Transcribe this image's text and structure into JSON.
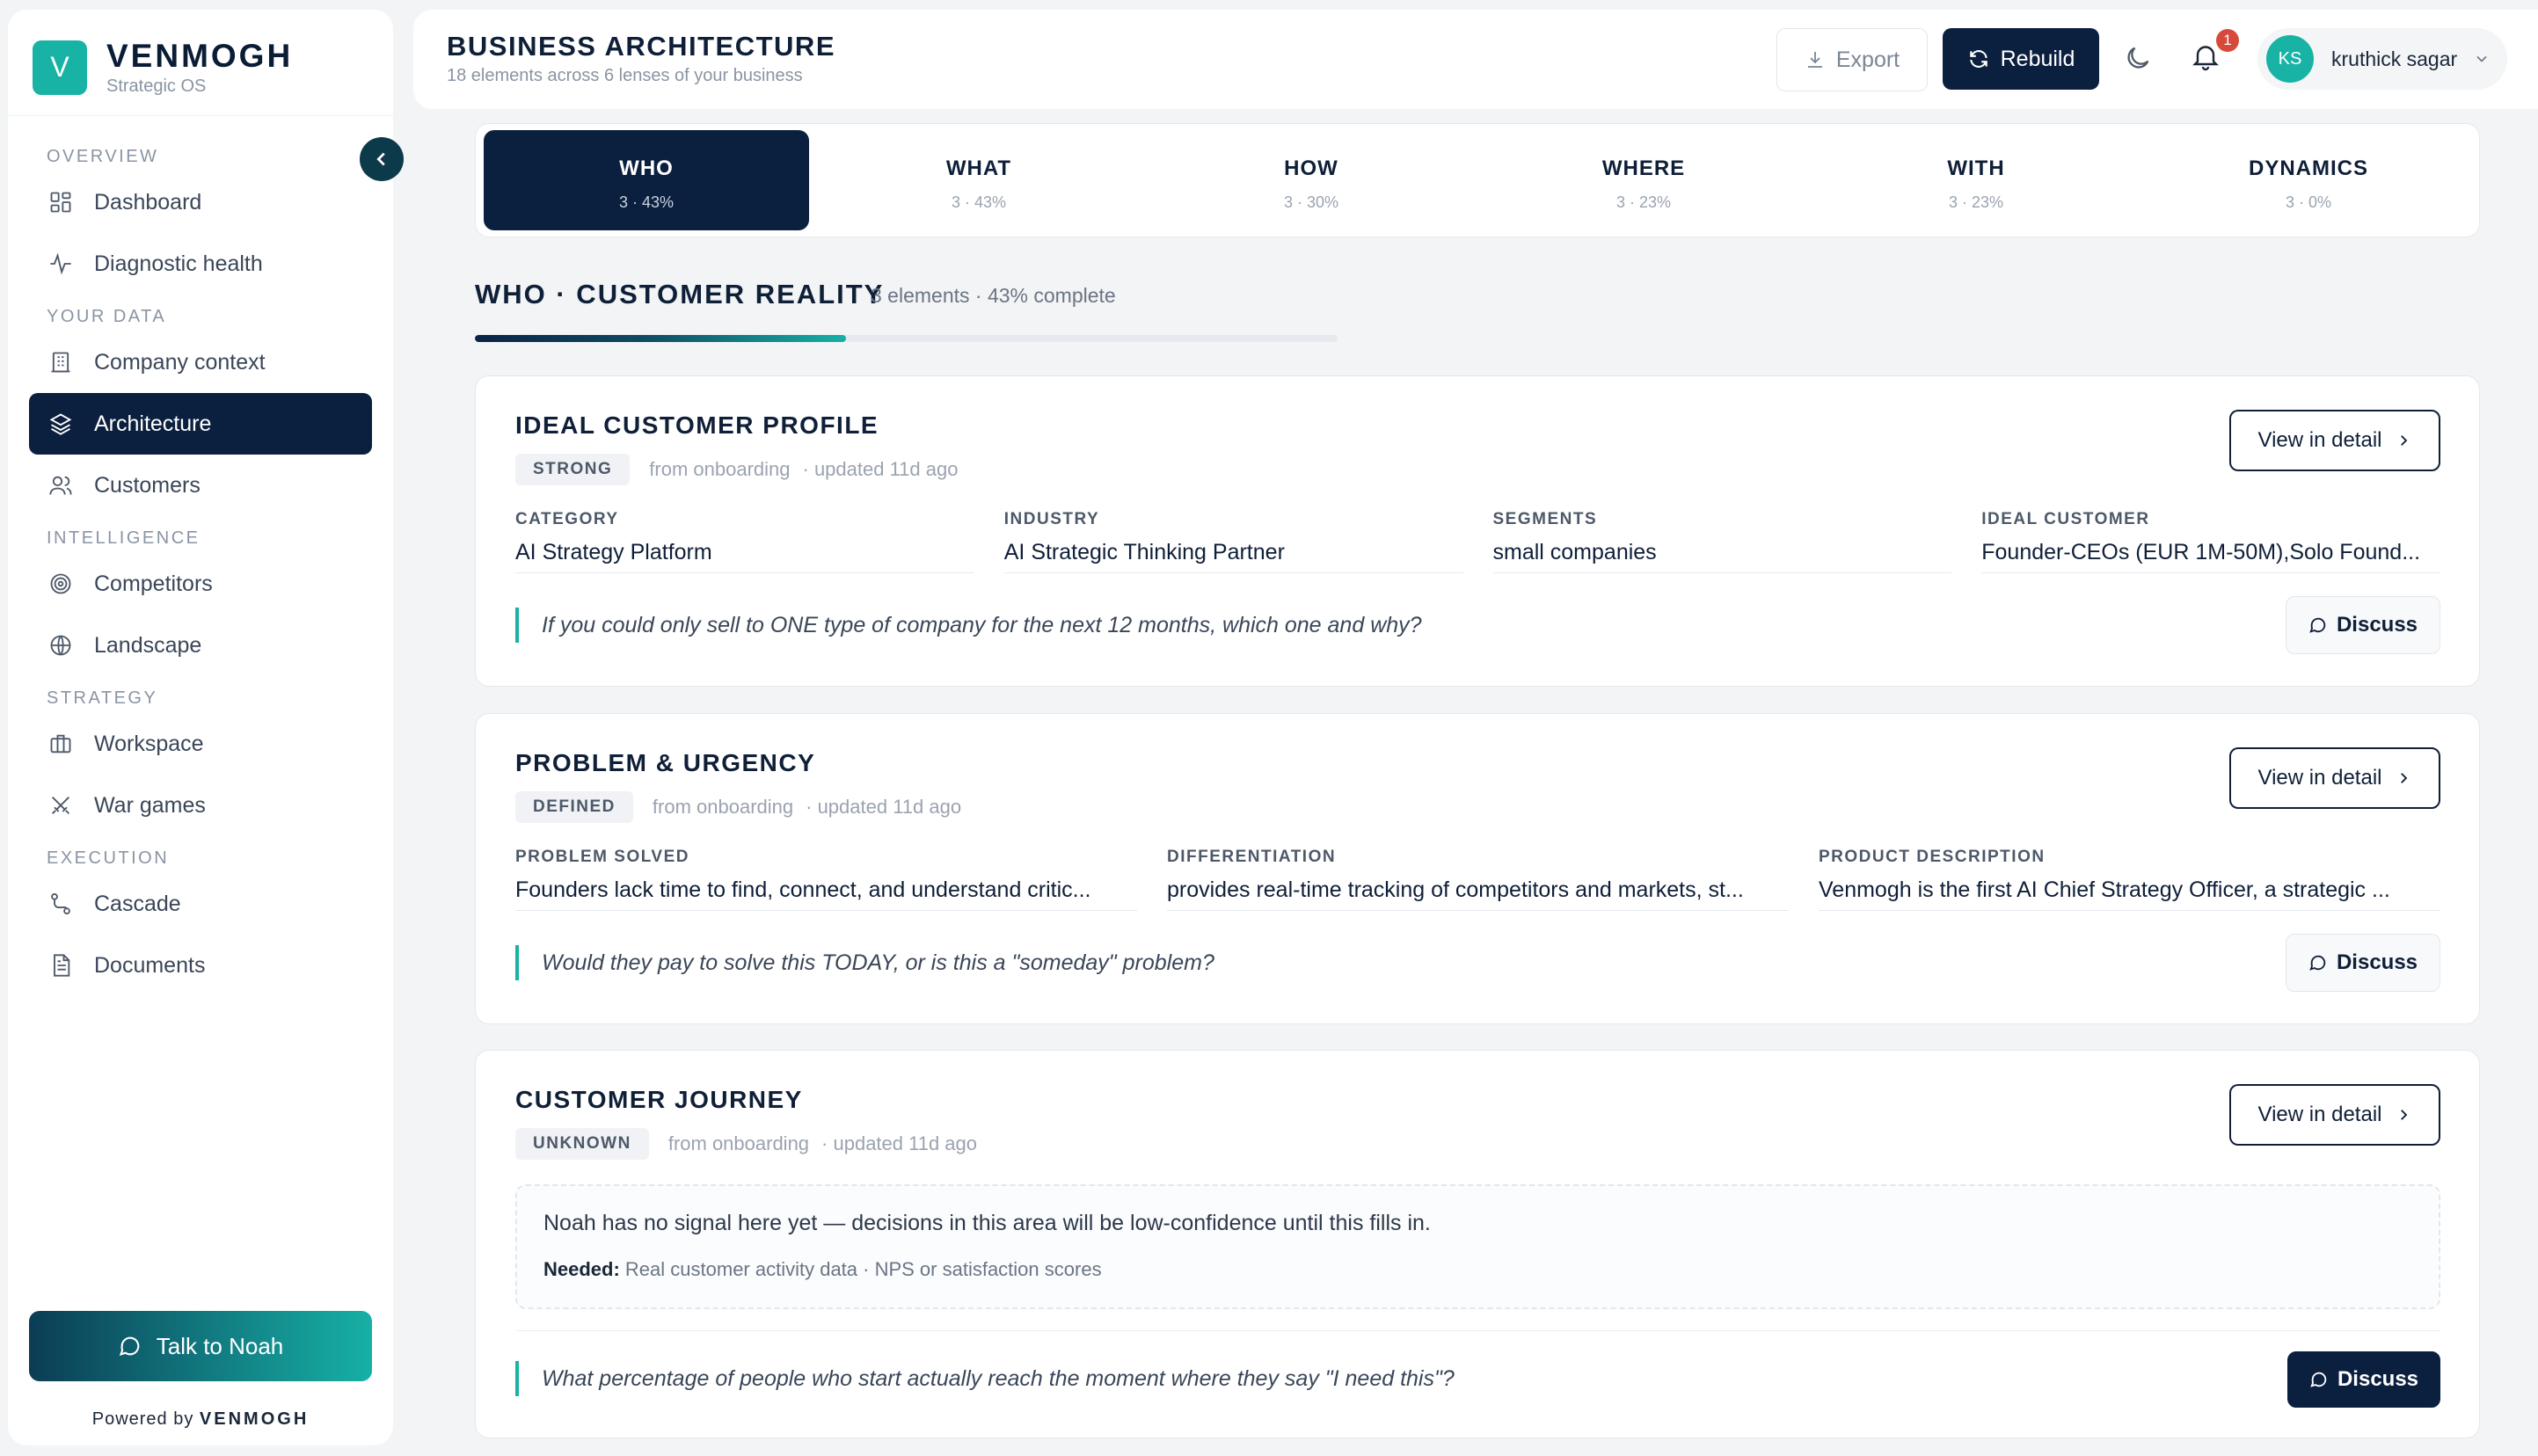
{
  "brand": {
    "initial": "V",
    "name": "VENMOGH",
    "subtitle": "Strategic OS"
  },
  "sidebar": {
    "sections": [
      {
        "label": "OVERVIEW",
        "items": [
          {
            "label": "Dashboard",
            "icon": "grid-icon"
          },
          {
            "label": "Diagnostic health",
            "icon": "pulse-icon"
          }
        ]
      },
      {
        "label": "YOUR DATA",
        "items": [
          {
            "label": "Company context",
            "icon": "building-icon"
          },
          {
            "label": "Architecture",
            "icon": "layers-icon",
            "active": true
          },
          {
            "label": "Customers",
            "icon": "users-icon"
          }
        ]
      },
      {
        "label": "INTELLIGENCE",
        "items": [
          {
            "label": "Competitors",
            "icon": "target-icon"
          },
          {
            "label": "Landscape",
            "icon": "globe-icon"
          }
        ]
      },
      {
        "label": "STRATEGY",
        "items": [
          {
            "label": "Workspace",
            "icon": "briefcase-icon"
          },
          {
            "label": "War games",
            "icon": "swords-icon"
          }
        ]
      },
      {
        "label": "EXECUTION",
        "items": [
          {
            "label": "Cascade",
            "icon": "route-icon"
          },
          {
            "label": "Documents",
            "icon": "document-icon"
          }
        ]
      }
    ],
    "talk_button": "Talk to Noah",
    "powered_prefix": "Powered by",
    "powered_brand": "VENMOGH"
  },
  "header": {
    "title": "BUSINESS ARCHITECTURE",
    "subtitle": "18 elements across 6 lenses of your business",
    "export_label": "Export",
    "rebuild_label": "Rebuild",
    "notification_count": "1",
    "user_initials": "KS",
    "user_name": "kruthick sagar"
  },
  "tabs": [
    {
      "label": "WHO",
      "meta": "3 · 43%",
      "active": true
    },
    {
      "label": "WHAT",
      "meta": "3 · 43%"
    },
    {
      "label": "HOW",
      "meta": "3 · 30%"
    },
    {
      "label": "WHERE",
      "meta": "3 · 23%"
    },
    {
      "label": "WITH",
      "meta": "3 · 23%"
    },
    {
      "label": "DYNAMICS",
      "meta": "3 · 0%"
    }
  ],
  "section": {
    "title": "WHO · CUSTOMER REALITY",
    "meta": "3 elements · 43% complete",
    "progress": 0.43
  },
  "cards": [
    {
      "title": "IDEAL CUSTOMER PROFILE",
      "status": "STRONG",
      "source": "from onboarding",
      "updated": "· updated 11d ago",
      "view_label": "View in detail",
      "fields": [
        {
          "label": "CATEGORY",
          "value": "AI Strategy Platform"
        },
        {
          "label": "INDUSTRY",
          "value": "AI Strategic Thinking Partner"
        },
        {
          "label": "SEGMENTS",
          "value": "small companies"
        },
        {
          "label": "IDEAL CUSTOMER",
          "value": "Founder-CEOs (EUR 1M-50M),Solo Found..."
        }
      ],
      "question": "If you could only sell to ONE type of company for the next 12 months, which one and why?",
      "discuss_label": "Discuss"
    },
    {
      "title": "PROBLEM & URGENCY",
      "status": "DEFINED",
      "source": "from onboarding",
      "updated": "· updated 11d ago",
      "view_label": "View in detail",
      "fields": [
        {
          "label": "PROBLEM SOLVED",
          "value": "Founders lack time to find, connect, and understand critic..."
        },
        {
          "label": "DIFFERENTIATION",
          "value": "provides real-time tracking of competitors and markets, st..."
        },
        {
          "label": "PRODUCT DESCRIPTION",
          "value": "Venmogh is the first AI Chief Strategy Officer, a strategic ..."
        }
      ],
      "question": "Would they pay to solve this TODAY, or is this a \"someday\" problem?",
      "discuss_label": "Discuss"
    },
    {
      "title": "CUSTOMER JOURNEY",
      "status": "UNKNOWN",
      "source": "from onboarding",
      "updated": "· updated 11d ago",
      "view_label": "View in detail",
      "signal_text": "Noah has no signal here yet — decisions in this area will be low-confidence until this fills in.",
      "needed_label": "Needed:",
      "needed_items": "Real customer activity data · NPS or satisfaction scores",
      "question": "What percentage of people who start actually reach the moment where they say \"I need this\"?",
      "discuss_label": "Discuss"
    }
  ]
}
